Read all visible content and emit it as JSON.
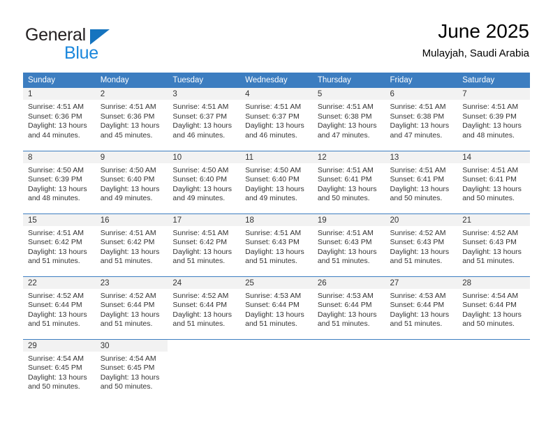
{
  "brand": {
    "name_part1": "General",
    "name_part2": "Blue",
    "color_dark": "#231f20",
    "color_blue": "#1b87dc",
    "triangle_color": "#1574bf",
    "triangle_icon": "triangle-right-icon"
  },
  "header": {
    "title": "June 2025",
    "subtitle": "Mulayjah, Saudi Arabia"
  },
  "theme": {
    "header_bg": "#3c7dc0",
    "header_text": "#ffffff",
    "daynum_bg": "#f2f2f2",
    "grid_line": "#3c7dc0",
    "body_text": "#333333"
  },
  "weekdays": [
    "Sunday",
    "Monday",
    "Tuesday",
    "Wednesday",
    "Thursday",
    "Friday",
    "Saturday"
  ],
  "weeks": [
    [
      {
        "day": "1",
        "sunrise": "Sunrise: 4:51 AM",
        "sunset": "Sunset: 6:36 PM",
        "daylight1": "Daylight: 13 hours",
        "daylight2": "and 44 minutes."
      },
      {
        "day": "2",
        "sunrise": "Sunrise: 4:51 AM",
        "sunset": "Sunset: 6:36 PM",
        "daylight1": "Daylight: 13 hours",
        "daylight2": "and 45 minutes."
      },
      {
        "day": "3",
        "sunrise": "Sunrise: 4:51 AM",
        "sunset": "Sunset: 6:37 PM",
        "daylight1": "Daylight: 13 hours",
        "daylight2": "and 46 minutes."
      },
      {
        "day": "4",
        "sunrise": "Sunrise: 4:51 AM",
        "sunset": "Sunset: 6:37 PM",
        "daylight1": "Daylight: 13 hours",
        "daylight2": "and 46 minutes."
      },
      {
        "day": "5",
        "sunrise": "Sunrise: 4:51 AM",
        "sunset": "Sunset: 6:38 PM",
        "daylight1": "Daylight: 13 hours",
        "daylight2": "and 47 minutes."
      },
      {
        "day": "6",
        "sunrise": "Sunrise: 4:51 AM",
        "sunset": "Sunset: 6:38 PM",
        "daylight1": "Daylight: 13 hours",
        "daylight2": "and 47 minutes."
      },
      {
        "day": "7",
        "sunrise": "Sunrise: 4:51 AM",
        "sunset": "Sunset: 6:39 PM",
        "daylight1": "Daylight: 13 hours",
        "daylight2": "and 48 minutes."
      }
    ],
    [
      {
        "day": "8",
        "sunrise": "Sunrise: 4:50 AM",
        "sunset": "Sunset: 6:39 PM",
        "daylight1": "Daylight: 13 hours",
        "daylight2": "and 48 minutes."
      },
      {
        "day": "9",
        "sunrise": "Sunrise: 4:50 AM",
        "sunset": "Sunset: 6:40 PM",
        "daylight1": "Daylight: 13 hours",
        "daylight2": "and 49 minutes."
      },
      {
        "day": "10",
        "sunrise": "Sunrise: 4:50 AM",
        "sunset": "Sunset: 6:40 PM",
        "daylight1": "Daylight: 13 hours",
        "daylight2": "and 49 minutes."
      },
      {
        "day": "11",
        "sunrise": "Sunrise: 4:50 AM",
        "sunset": "Sunset: 6:40 PM",
        "daylight1": "Daylight: 13 hours",
        "daylight2": "and 49 minutes."
      },
      {
        "day": "12",
        "sunrise": "Sunrise: 4:51 AM",
        "sunset": "Sunset: 6:41 PM",
        "daylight1": "Daylight: 13 hours",
        "daylight2": "and 50 minutes."
      },
      {
        "day": "13",
        "sunrise": "Sunrise: 4:51 AM",
        "sunset": "Sunset: 6:41 PM",
        "daylight1": "Daylight: 13 hours",
        "daylight2": "and 50 minutes."
      },
      {
        "day": "14",
        "sunrise": "Sunrise: 4:51 AM",
        "sunset": "Sunset: 6:41 PM",
        "daylight1": "Daylight: 13 hours",
        "daylight2": "and 50 minutes."
      }
    ],
    [
      {
        "day": "15",
        "sunrise": "Sunrise: 4:51 AM",
        "sunset": "Sunset: 6:42 PM",
        "daylight1": "Daylight: 13 hours",
        "daylight2": "and 51 minutes."
      },
      {
        "day": "16",
        "sunrise": "Sunrise: 4:51 AM",
        "sunset": "Sunset: 6:42 PM",
        "daylight1": "Daylight: 13 hours",
        "daylight2": "and 51 minutes."
      },
      {
        "day": "17",
        "sunrise": "Sunrise: 4:51 AM",
        "sunset": "Sunset: 6:42 PM",
        "daylight1": "Daylight: 13 hours",
        "daylight2": "and 51 minutes."
      },
      {
        "day": "18",
        "sunrise": "Sunrise: 4:51 AM",
        "sunset": "Sunset: 6:43 PM",
        "daylight1": "Daylight: 13 hours",
        "daylight2": "and 51 minutes."
      },
      {
        "day": "19",
        "sunrise": "Sunrise: 4:51 AM",
        "sunset": "Sunset: 6:43 PM",
        "daylight1": "Daylight: 13 hours",
        "daylight2": "and 51 minutes."
      },
      {
        "day": "20",
        "sunrise": "Sunrise: 4:52 AM",
        "sunset": "Sunset: 6:43 PM",
        "daylight1": "Daylight: 13 hours",
        "daylight2": "and 51 minutes."
      },
      {
        "day": "21",
        "sunrise": "Sunrise: 4:52 AM",
        "sunset": "Sunset: 6:43 PM",
        "daylight1": "Daylight: 13 hours",
        "daylight2": "and 51 minutes."
      }
    ],
    [
      {
        "day": "22",
        "sunrise": "Sunrise: 4:52 AM",
        "sunset": "Sunset: 6:44 PM",
        "daylight1": "Daylight: 13 hours",
        "daylight2": "and 51 minutes."
      },
      {
        "day": "23",
        "sunrise": "Sunrise: 4:52 AM",
        "sunset": "Sunset: 6:44 PM",
        "daylight1": "Daylight: 13 hours",
        "daylight2": "and 51 minutes."
      },
      {
        "day": "24",
        "sunrise": "Sunrise: 4:52 AM",
        "sunset": "Sunset: 6:44 PM",
        "daylight1": "Daylight: 13 hours",
        "daylight2": "and 51 minutes."
      },
      {
        "day": "25",
        "sunrise": "Sunrise: 4:53 AM",
        "sunset": "Sunset: 6:44 PM",
        "daylight1": "Daylight: 13 hours",
        "daylight2": "and 51 minutes."
      },
      {
        "day": "26",
        "sunrise": "Sunrise: 4:53 AM",
        "sunset": "Sunset: 6:44 PM",
        "daylight1": "Daylight: 13 hours",
        "daylight2": "and 51 minutes."
      },
      {
        "day": "27",
        "sunrise": "Sunrise: 4:53 AM",
        "sunset": "Sunset: 6:44 PM",
        "daylight1": "Daylight: 13 hours",
        "daylight2": "and 51 minutes."
      },
      {
        "day": "28",
        "sunrise": "Sunrise: 4:54 AM",
        "sunset": "Sunset: 6:44 PM",
        "daylight1": "Daylight: 13 hours",
        "daylight2": "and 50 minutes."
      }
    ],
    [
      {
        "day": "29",
        "sunrise": "Sunrise: 4:54 AM",
        "sunset": "Sunset: 6:45 PM",
        "daylight1": "Daylight: 13 hours",
        "daylight2": "and 50 minutes."
      },
      {
        "day": "30",
        "sunrise": "Sunrise: 4:54 AM",
        "sunset": "Sunset: 6:45 PM",
        "daylight1": "Daylight: 13 hours",
        "daylight2": "and 50 minutes."
      },
      {
        "day": "",
        "sunrise": "",
        "sunset": "",
        "daylight1": "",
        "daylight2": ""
      },
      {
        "day": "",
        "sunrise": "",
        "sunset": "",
        "daylight1": "",
        "daylight2": ""
      },
      {
        "day": "",
        "sunrise": "",
        "sunset": "",
        "daylight1": "",
        "daylight2": ""
      },
      {
        "day": "",
        "sunrise": "",
        "sunset": "",
        "daylight1": "",
        "daylight2": ""
      },
      {
        "day": "",
        "sunrise": "",
        "sunset": "",
        "daylight1": "",
        "daylight2": ""
      }
    ]
  ]
}
